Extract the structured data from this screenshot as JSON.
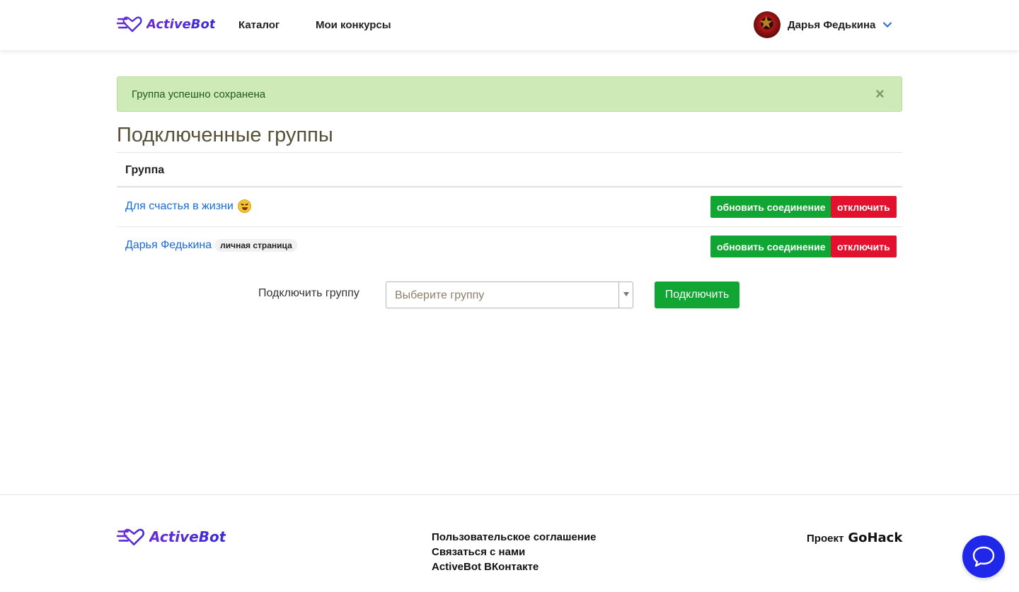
{
  "header": {
    "logo_text": "ActiveBot",
    "nav": [
      {
        "label": "Каталог"
      },
      {
        "label": "Мои конкурсы"
      }
    ],
    "user_name": "Дарья Федькина"
  },
  "alert": {
    "message": "Группа успешно сохранена",
    "close_glyph": "×"
  },
  "page_title": "Подключенные группы",
  "table": {
    "header": "Группа",
    "rows": [
      {
        "name": "Для счастья в жизни",
        "badge": "",
        "refresh_label": "обновить соединение",
        "disconnect_label": "отключить"
      },
      {
        "name": "Дарья Федькина",
        "badge": "личная страница",
        "refresh_label": "обновить соединение",
        "disconnect_label": "отключить"
      }
    ]
  },
  "connect": {
    "label": "Подключить группу",
    "select_placeholder": "Выберите группу",
    "button_label": "Подключить"
  },
  "footer": {
    "logo_text": "ActiveBot",
    "links": [
      {
        "label": "Пользовательское соглашение"
      },
      {
        "label": "Связаться с нами"
      },
      {
        "label": "ActiveBot ВКонтакте"
      }
    ],
    "project_label": "Проект",
    "project_brand": "GoHack"
  },
  "colors": {
    "accent_purple": "#6a2bd8",
    "success_green": "#11a533",
    "danger_red": "#e3102e",
    "link_blue": "#1a6bd6",
    "alert_bg": "#cdeab7",
    "chat_blue": "#1f27e8"
  },
  "icons": [
    "logo-heart-icon",
    "chevron-down-icon",
    "close-icon",
    "laughing-emoji-icon",
    "select-arrow-icon",
    "chat-bubble-icon"
  ]
}
